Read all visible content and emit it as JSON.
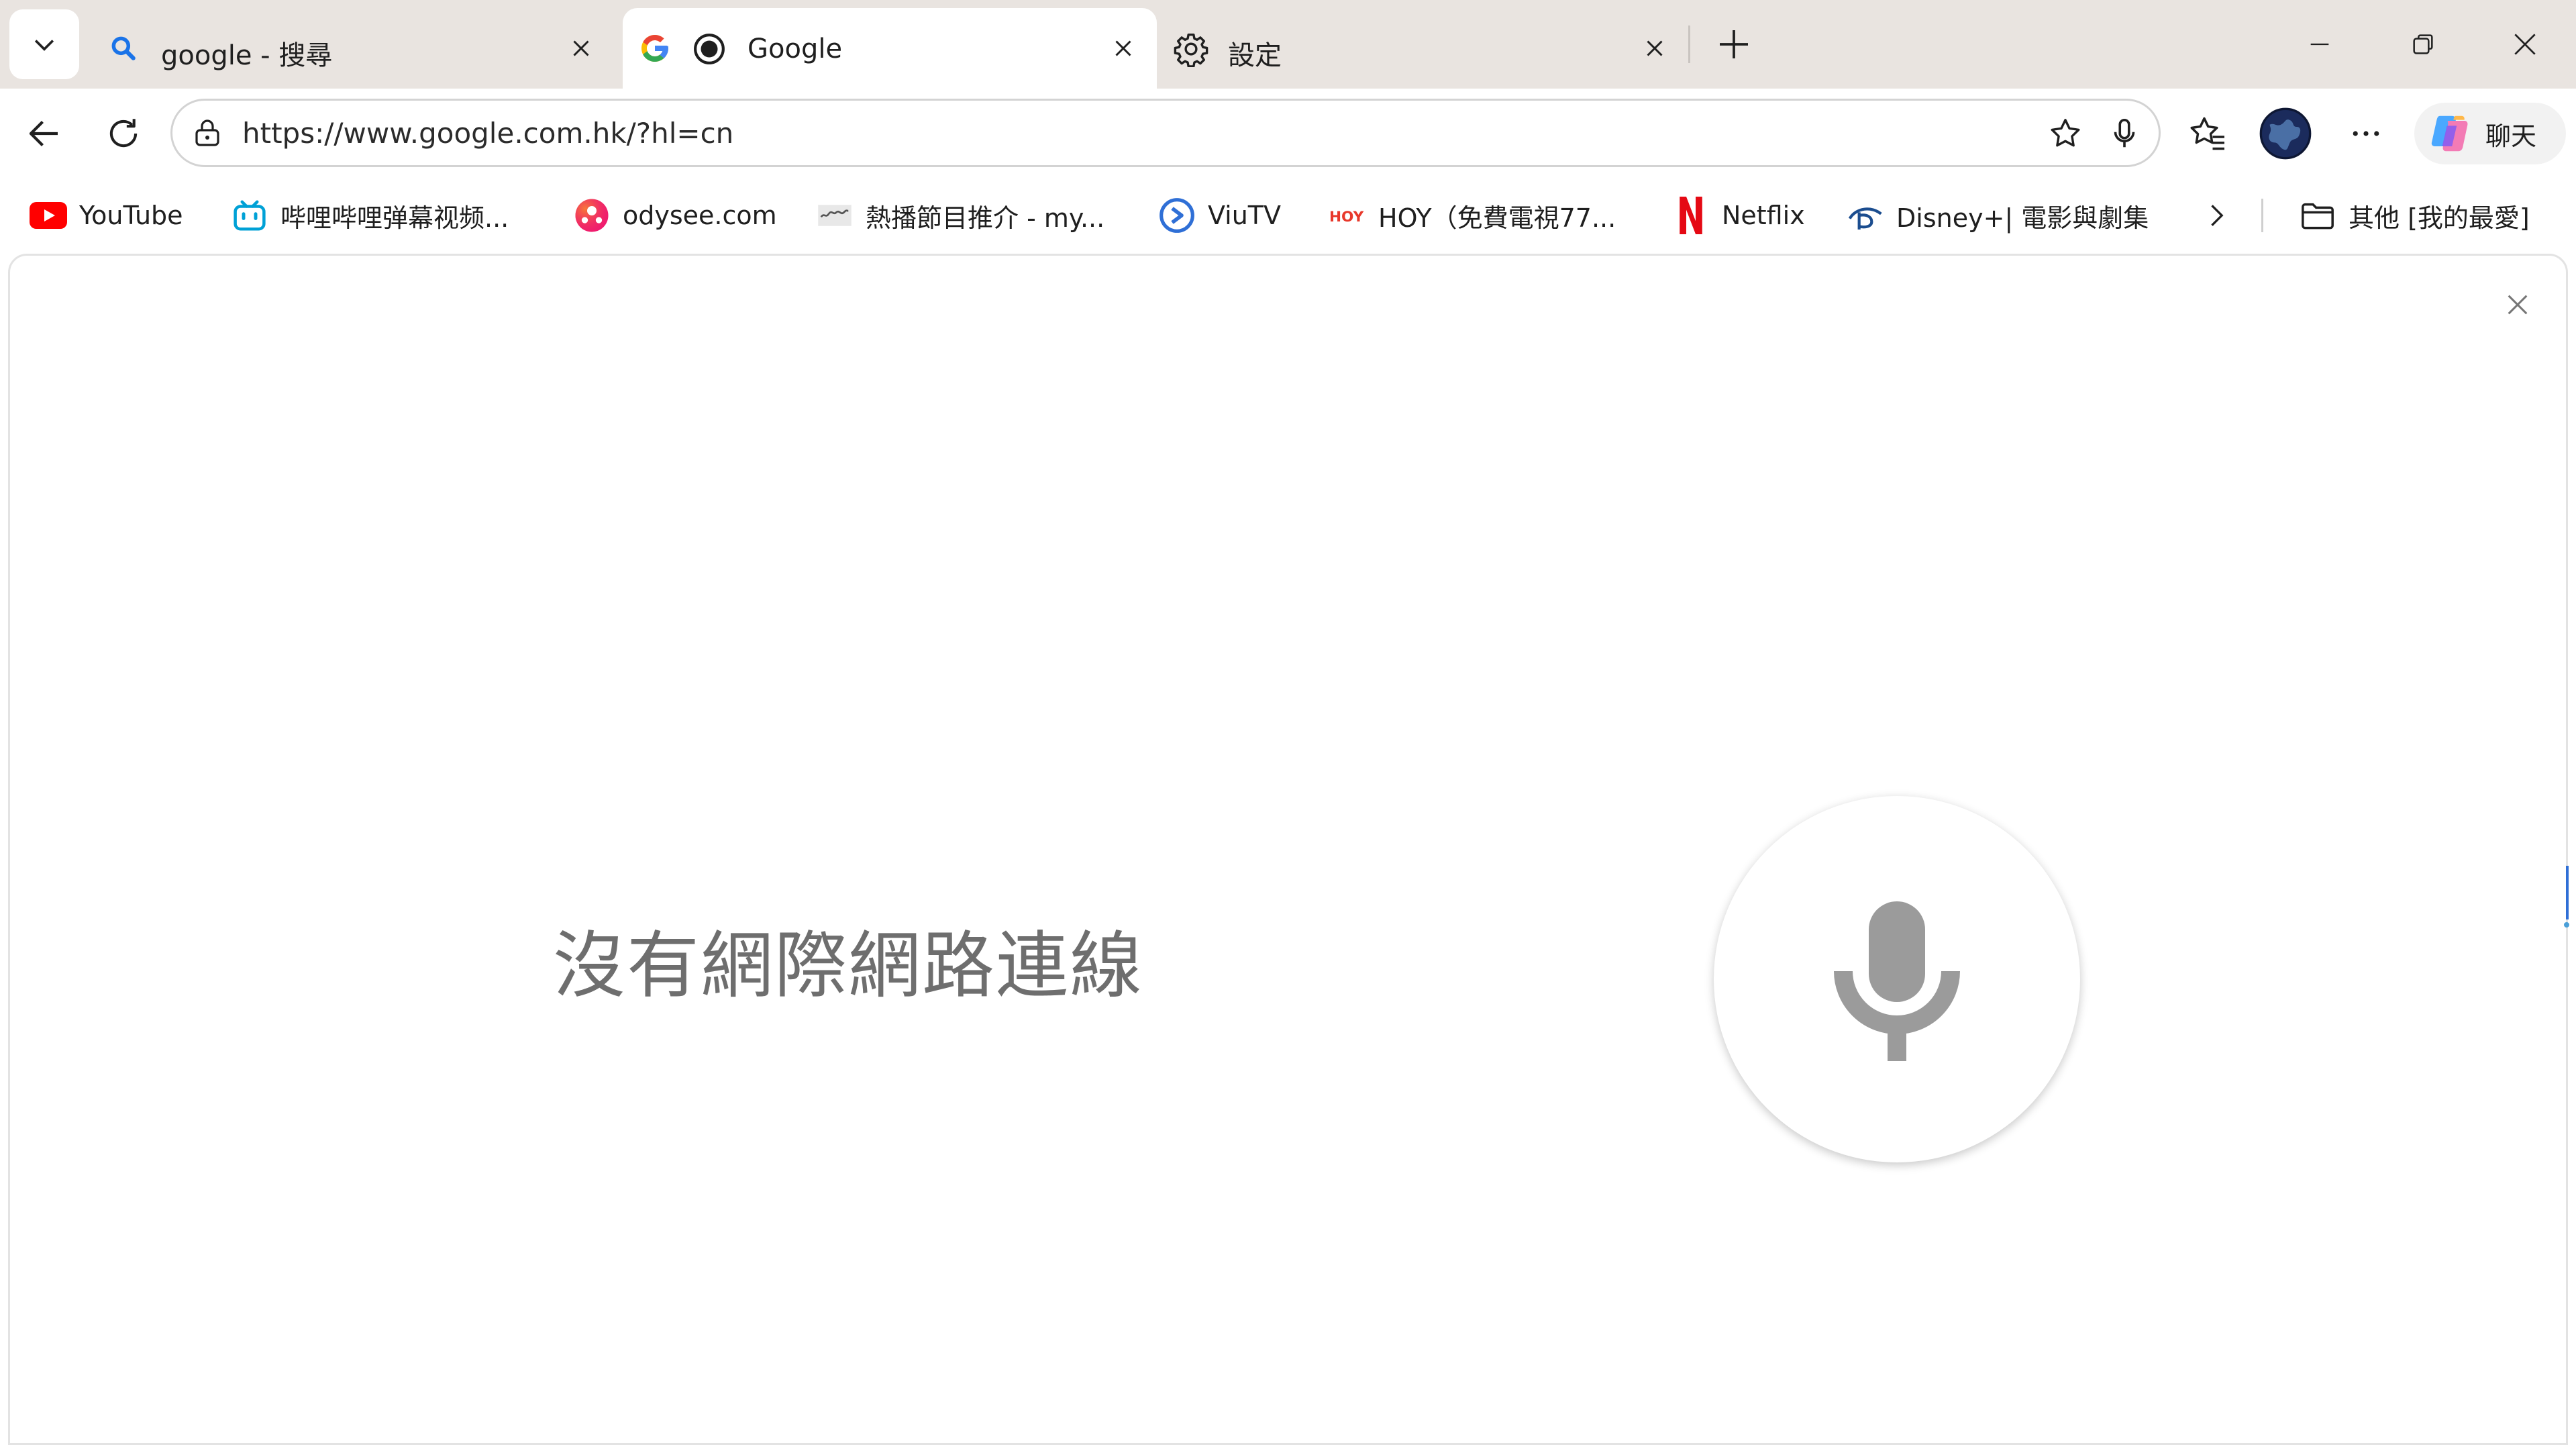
{
  "tabs": [
    {
      "title": "google - 搜尋",
      "icon": "search-icon",
      "active": false
    },
    {
      "title": "Google",
      "icon": "google-logo-icon",
      "active": true
    },
    {
      "title": "設定",
      "icon": "gear-icon",
      "active": false
    }
  ],
  "address_bar": {
    "url": "https://www.google.com.hk/?hl=cn"
  },
  "copilot": {
    "label": "聊天"
  },
  "favorites": [
    {
      "label": "YouTube",
      "icon": "youtube-icon"
    },
    {
      "label": "哔哩哔哩弹幕视频...",
      "icon": "bilibili-icon"
    },
    {
      "label": "odysee.com",
      "icon": "odysee-icon"
    },
    {
      "label": "熱播節目推介 - my...",
      "icon": "mytv-icon"
    },
    {
      "label": "ViuTV",
      "icon": "viutv-icon"
    },
    {
      "label": "HOY（免費電視77...",
      "icon": "hoy-icon"
    },
    {
      "label": "Netflix",
      "icon": "netflix-icon"
    },
    {
      "label": "Disney+| 電影與劇集",
      "icon": "disney-icon"
    }
  ],
  "other_favorites": {
    "label": "其他 [我的最愛]"
  },
  "content": {
    "message": "沒有網際網路連線"
  },
  "colors": {
    "tabstrip": "#e9e4e0",
    "google_blue": "#4285f4",
    "mic_gray": "#9b9b9b"
  }
}
